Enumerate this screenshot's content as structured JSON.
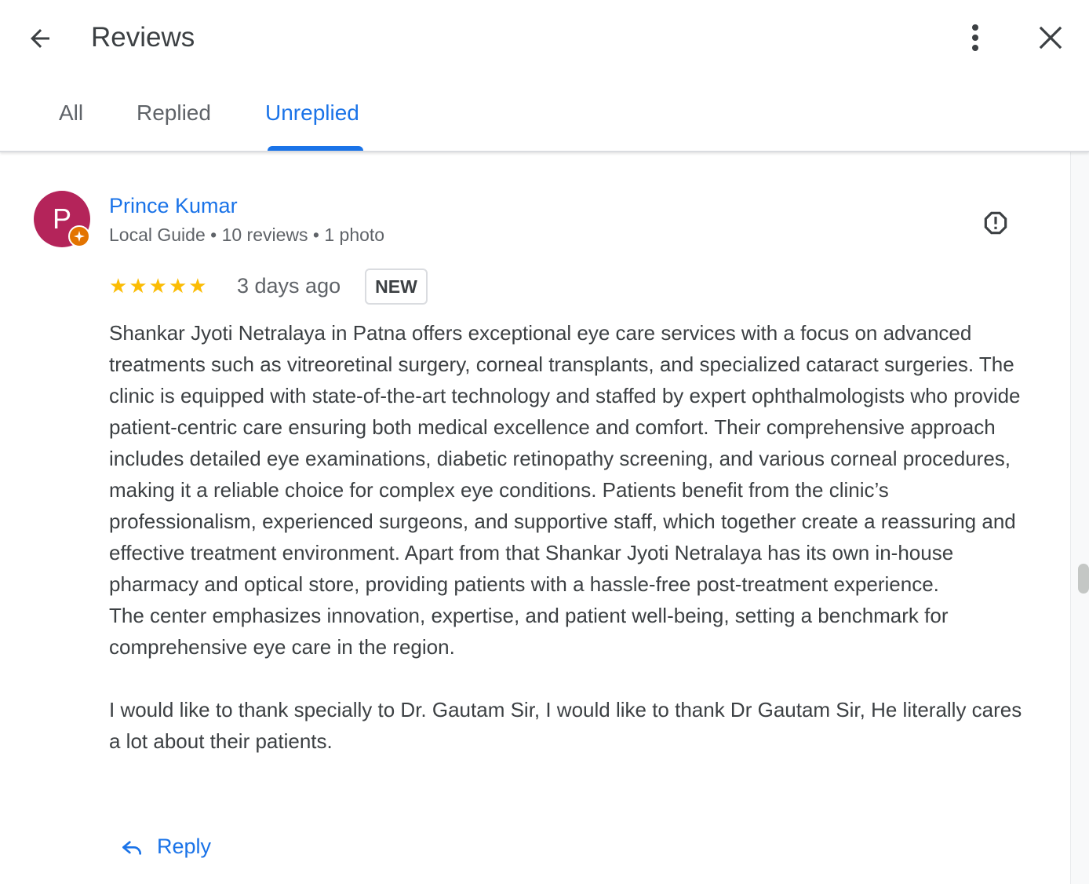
{
  "header": {
    "title": "Reviews",
    "back_icon": "arrow-back-icon",
    "more_icon": "more-vert-icon",
    "close_icon": "close-icon"
  },
  "tabs": [
    {
      "label": "All",
      "active": false
    },
    {
      "label": "Replied",
      "active": false
    },
    {
      "label": "Unreplied",
      "active": true
    }
  ],
  "review": {
    "avatar_initial": "P",
    "avatar_color": "#b4245a",
    "reviewer_name": "Prince Kumar",
    "reviewer_meta": "Local Guide • 10 reviews • 1 photo",
    "rating": 5,
    "time": "3 days ago",
    "badge": "NEW",
    "paragraphs": [
      "Shankar Jyoti Netralaya in Patna offers exceptional eye care services with a focus on advanced treatments such as vitreoretinal surgery, corneal transplants, and specialized cataract surgeries. The clinic is equipped with state-of-the-art technology and staffed by expert ophthalmologists who provide patient-centric care ensuring both medical excellence and comfort. Their comprehensive approach includes detailed eye examinations, diabetic retinopathy screening, and various corneal procedures, making it a reliable choice for complex eye conditions. Patients benefit from the clinic’s professionalism, experienced surgeons, and supportive staff, which together create a reassuring and effective treatment environment. Apart from that Shankar Jyoti Netralaya has its own in-house pharmacy and optical store, providing patients with a hassle-free post-treatment experience.",
      "The center emphasizes innovation, expertise, and patient well-being, setting a benchmark for comprehensive eye care in the region.",
      "I would like to thank specially to Dr. Gautam Sir, I would like to thank Dr Gautam Sir, He literally cares a lot about their patients."
    ],
    "reply_label": "Reply"
  },
  "colors": {
    "accent": "#1a73e8",
    "star": "#fbbc04",
    "local_guide_badge": "#e37400"
  }
}
